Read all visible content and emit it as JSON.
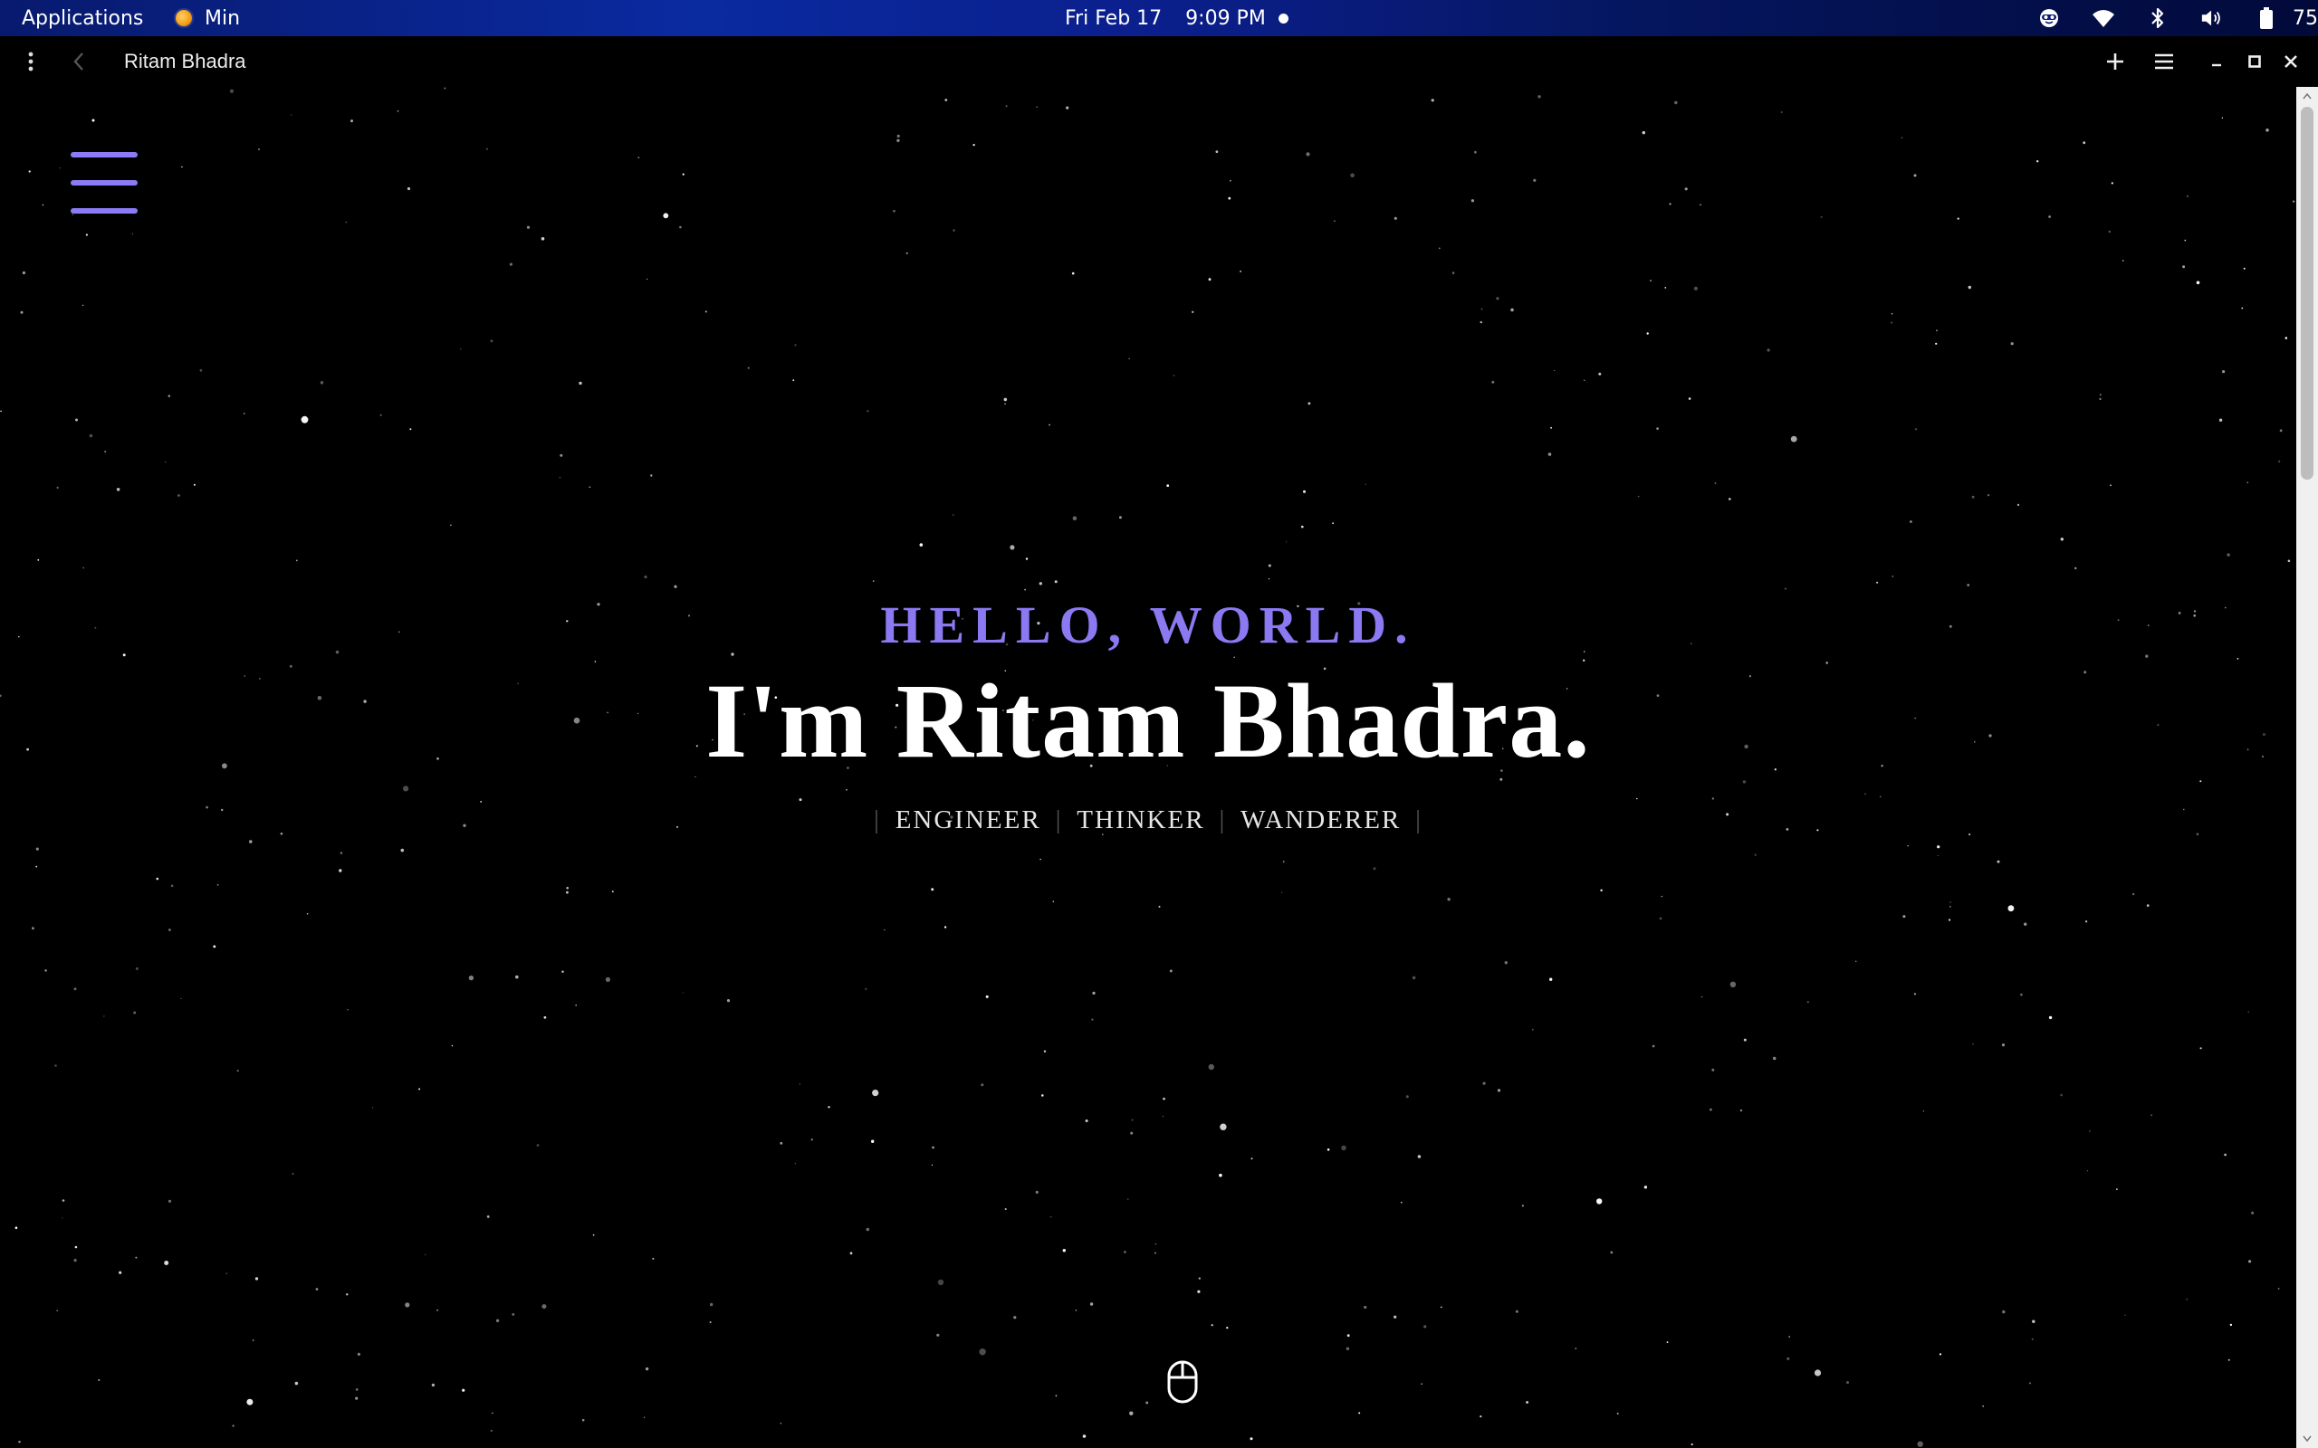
{
  "os_panel": {
    "applications_label": "Applications",
    "active_app": "Min",
    "date": "Fri Feb 17",
    "time": "9:09 PM",
    "battery_percent": "75 %"
  },
  "browser": {
    "tab_title": "Ritam Bhadra",
    "icons": [
      "menu-dots-icon",
      "back-icon",
      "plus-icon",
      "tabs-list-icon",
      "minimize-icon",
      "maximize-icon",
      "close-icon"
    ]
  },
  "page": {
    "greeting": "HELLO, WORLD.",
    "name": "I'm Ritam Bhadra.",
    "roles": [
      "ENGINEER",
      "THINKER",
      "WANDERER"
    ],
    "role_separator": "|",
    "accent_color": "#8b79f1",
    "background_color": "#000000"
  }
}
